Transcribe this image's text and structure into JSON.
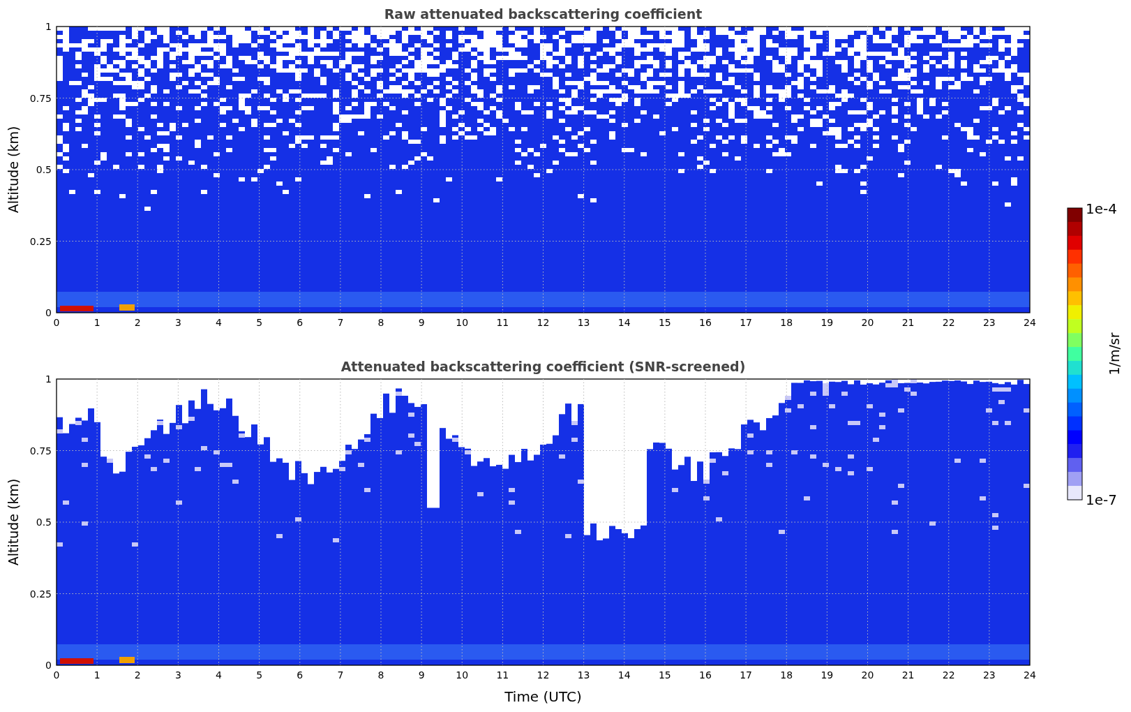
{
  "plots": [
    {
      "kind": "raw",
      "title": "Raw attenuated backscattering coefficient",
      "ylabel": "Altitude (km)",
      "yticks": [
        "1",
        "0.75",
        "0.5",
        "0.25",
        "0"
      ],
      "xticks": [
        "0",
        "1",
        "2",
        "3",
        "4",
        "5",
        "6",
        "7",
        "8",
        "9",
        "10",
        "11",
        "12",
        "13",
        "14",
        "15",
        "16",
        "17",
        "18",
        "19",
        "20",
        "21",
        "22",
        "23",
        "24"
      ]
    },
    {
      "kind": "screened",
      "title": "Attenuated backscattering coefficient (SNR-screened)",
      "ylabel": "Altitude (km)",
      "yticks": [
        "1",
        "0.75",
        "0.5",
        "0.25",
        "0"
      ],
      "xticks": [
        "0",
        "1",
        "2",
        "3",
        "4",
        "5",
        "6",
        "7",
        "8",
        "9",
        "10",
        "11",
        "12",
        "13",
        "14",
        "15",
        "16",
        "17",
        "18",
        "19",
        "20",
        "21",
        "22",
        "23",
        "24"
      ]
    }
  ],
  "xlabel": "Time (UTC)",
  "colorbar": {
    "label": "1/m/sr",
    "max": "1e-4",
    "min": "1e-7"
  }
}
